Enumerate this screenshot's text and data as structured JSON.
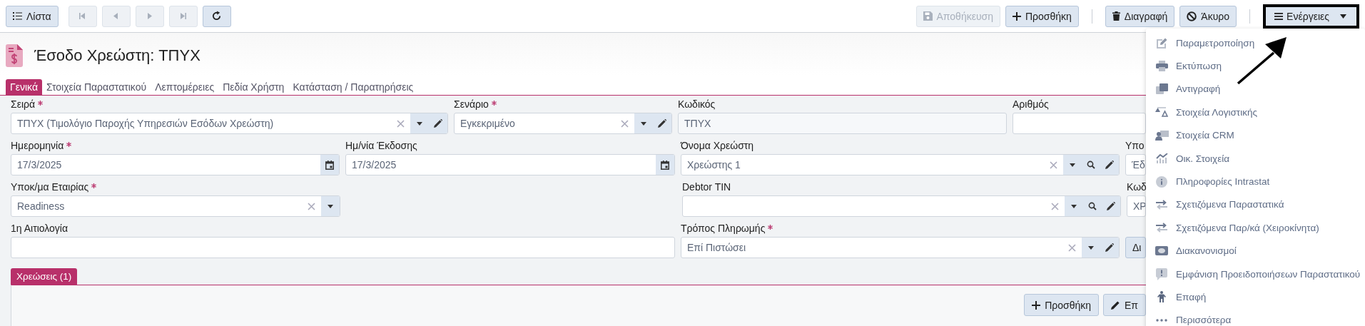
{
  "toolbar": {
    "list_button": "Λίστα",
    "nav_buttons": [
      {
        "kind": "first",
        "disabled": true
      },
      {
        "kind": "prev",
        "disabled": true
      },
      {
        "kind": "next",
        "disabled": true
      },
      {
        "kind": "last",
        "disabled": true
      },
      {
        "kind": "refresh",
        "disabled": false
      }
    ],
    "actions": [
      {
        "kind": "save",
        "label": "Αποθήκευση",
        "disabled": true
      },
      {
        "kind": "add",
        "label": "Προσθήκη",
        "disabled": false
      },
      {
        "kind": "separator"
      },
      {
        "kind": "delete",
        "label": "Διαγραφή",
        "disabled": false
      },
      {
        "kind": "cancel",
        "label": "Άκυρο",
        "disabled": false
      },
      {
        "kind": "separator"
      }
    ],
    "menu_button": {
      "label": "Ενέργειες",
      "highlighted": true,
      "expanded": true
    }
  },
  "header": {
    "title": "Έσοδο Χρεώστη: ΤΠΥΧ"
  },
  "tabs": [
    {
      "label": "Γενικά",
      "selected": true
    },
    {
      "label": "Στοιχεία Παραστατικού",
      "selected": false
    },
    {
      "label": "Λεπτομέρειες",
      "selected": false
    },
    {
      "label": "Πεδία Χρήστη",
      "selected": false
    },
    {
      "label": "Κατάσταση / Παρατηρήσεις",
      "selected": false
    }
  ],
  "form": {
    "rows": [
      [
        {
          "kind": "select",
          "label": "Σειρά",
          "required": true,
          "value": "ΤΠΥΧ (Τιμολόγιο Παροχής Υπηρεσιών Εσόδων Χρεώστη)",
          "clearable": true,
          "dropdown": true,
          "editable": true
        },
        {
          "kind": "select",
          "label": "Σενάριο",
          "required": true,
          "value": "Εγκεκριμένο",
          "clearable": true,
          "dropdown": true,
          "editable": true
        },
        {
          "kind": "readonly",
          "label": "Κωδικός",
          "required": false,
          "value": "ΤΠΥΧ"
        },
        {
          "kind": "text",
          "label": "Αριθμός",
          "required": false
        }
      ],
      [
        {
          "kind": "date",
          "label": "Ημερομηνία",
          "required": true,
          "value": "17/3/2025"
        },
        {
          "kind": "date",
          "label": "Ημ/νία Έκδοσης",
          "required": false,
          "value": "17/3/2025"
        },
        {
          "kind": "select",
          "label": "Όνομα Χρεώστη",
          "required": false,
          "value": "Χρεώστης 1",
          "clearable": true,
          "dropdown": true,
          "searchable": true,
          "editable": true
        },
        {
          "kind": "text",
          "label": "Υπο",
          "required": false,
          "value": "Έδ"
        }
      ],
      [
        {
          "kind": "select",
          "label": "Υποκ/μα Εταιρίας",
          "required": true,
          "value": "Readiness",
          "clearable": true,
          "dropdown": true
        },
        {
          "kind": "empty"
        },
        {
          "kind": "select",
          "label": "Debtor TIN",
          "required": false,
          "clearable": true,
          "dropdown": true,
          "searchable": true,
          "editable": true
        },
        {
          "kind": "text",
          "label": "Κωδ",
          "required": false,
          "value": "ΧΡ"
        }
      ],
      [
        {
          "kind": "text",
          "label": "1η Αιτιολογία",
          "required": false
        },
        {
          "kind": "continued"
        },
        {
          "kind": "select",
          "label": "Τρόπος Πληρωμής",
          "required": true,
          "value": "Επί Πιστώσει",
          "clearable": true,
          "dropdown": true,
          "editable": true
        },
        {
          "kind": "button",
          "label": "Δι"
        }
      ]
    ]
  },
  "subtabs": [
    {
      "label": "Χρεώσεις (1)",
      "selected": true
    }
  ],
  "grid_buttons": [
    {
      "kind": "add",
      "label": "Προσθήκη"
    },
    {
      "kind": "edit",
      "label": "Επ"
    }
  ],
  "menu": {
    "items": [
      {
        "kind": "edit",
        "label": "Παραμετροποίηση"
      },
      {
        "kind": "print",
        "label": "Εκτύπωση"
      },
      {
        "kind": "copy",
        "label": "Αντιγραφή"
      },
      {
        "kind": "scale",
        "label": "Στοιχεία Λογιστικής"
      },
      {
        "kind": "crm",
        "label": "Στοιχεία CRM"
      },
      {
        "kind": "chart",
        "label": "Οικ. Στοιχεία"
      },
      {
        "kind": "info",
        "label": "Πληροφορίες Intrastat"
      },
      {
        "kind": "swap",
        "label": "Σχετιζόμενα Παραστατικά"
      },
      {
        "kind": "swap",
        "label": "Σχετιζόμενα Παρ/κά (Χειροκίνητα)"
      },
      {
        "kind": "money",
        "label": "Διακανονισμοί"
      },
      {
        "kind": "alert",
        "label": "Εμφάνιση Προειδοποιήσεων Παραστατικού"
      },
      {
        "kind": "person",
        "label": "Επαφή"
      },
      {
        "kind": "dots",
        "label": "Περισσότερα"
      }
    ]
  }
}
